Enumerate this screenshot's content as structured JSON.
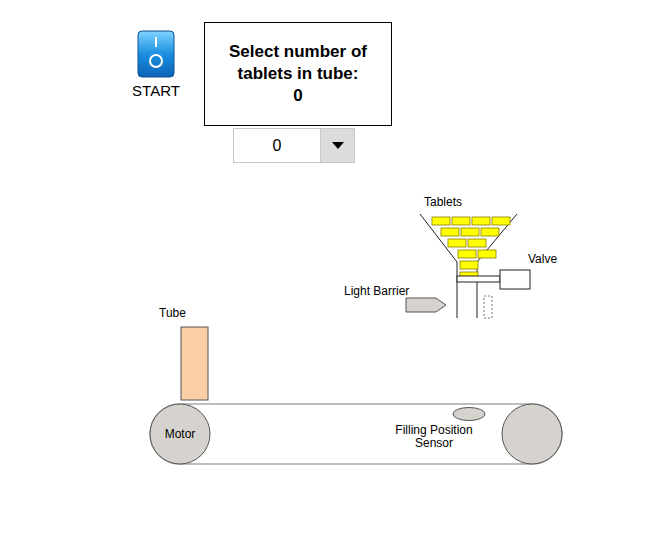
{
  "start": {
    "label": "START",
    "on": false
  },
  "prompt": {
    "title": "Select number of tablets in tube:",
    "value": "0"
  },
  "dropdown": {
    "value": "0"
  },
  "diagram": {
    "hopper_tablets": 13,
    "valve_open": false,
    "labels": {
      "tablets": "Tablets",
      "valve": "Valve",
      "light_barrier": "Light Barrier",
      "tube": "Tube",
      "motor": "Motor",
      "sensor": "Filling Position Sensor"
    }
  }
}
